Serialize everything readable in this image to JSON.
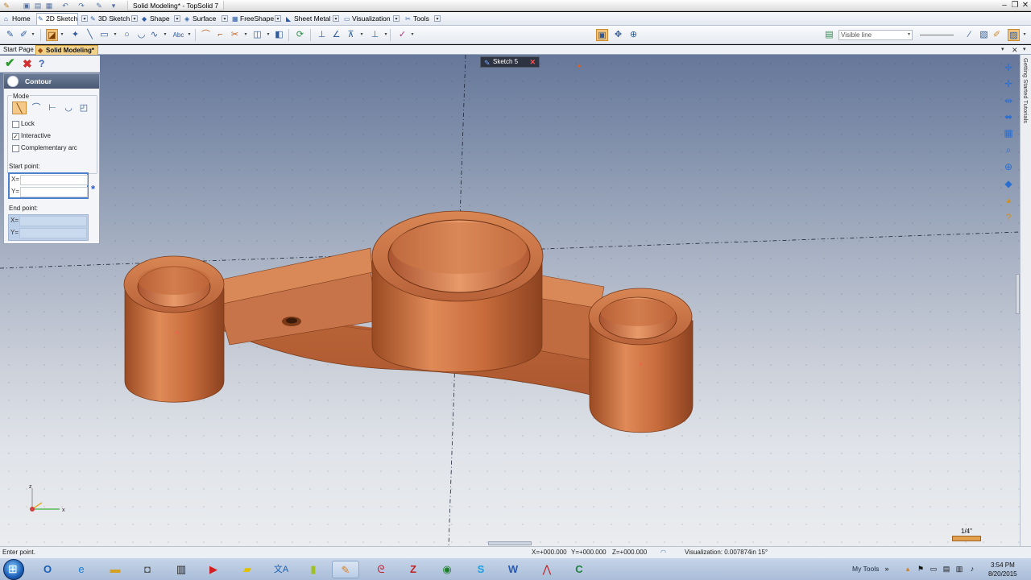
{
  "window": {
    "title": "Solid Modeling* - TopSolid 7",
    "minimize": "–",
    "restore": "❐",
    "close": "✕"
  },
  "menu": [
    {
      "label": "Home",
      "icon": "home-icon"
    },
    {
      "label": "2D Sketch",
      "icon": "pencil-icon"
    },
    {
      "label": "3D Sketch",
      "icon": "pencil-3d-icon"
    },
    {
      "label": "Shape",
      "icon": "shape-icon"
    },
    {
      "label": "Surface",
      "icon": "surface-icon"
    },
    {
      "label": "FreeShape",
      "icon": "freeshape-icon"
    },
    {
      "label": "Sheet Metal",
      "icon": "sheet-metal-icon"
    },
    {
      "label": "Visualization",
      "icon": "visualization-icon"
    },
    {
      "label": "Tools",
      "icon": "tools-icon"
    }
  ],
  "toolbar": {
    "layer_value": "Visible line"
  },
  "doc_tabs": {
    "start": "Start Page",
    "active": "Solid Modeling*"
  },
  "sketch_tab": {
    "label": "Sketch 5"
  },
  "contour": {
    "title": "Contour",
    "mode_label": "Mode",
    "lock_label": "Lock",
    "lock_checked": false,
    "interactive_label": "Interactive",
    "interactive_checked": true,
    "complementary_label": "Complementary arc",
    "complementary_checked": false,
    "start_point_label": "Start point:",
    "end_point_label": "End point:",
    "x_label": "X=",
    "y_label": "Y=",
    "start_x": "",
    "start_y": "",
    "end_x": "",
    "end_y": "",
    "pick_marker": "*"
  },
  "side_panel": {
    "label": "Getting Started Tutorials"
  },
  "scale": {
    "label": "1/4\""
  },
  "triad": {
    "x": "x",
    "z": "z"
  },
  "status": {
    "prompt": "Enter point.",
    "x": "X=+000.000",
    "y": "Y=+000.000",
    "z": "Z=+000.000",
    "visualization": "Visualization: 0.007874in 15°"
  },
  "taskbar": {
    "my_tools": "My Tools",
    "time": "3:54 PM",
    "date": "8/20/2015"
  },
  "colors": {
    "part_copper": "#c0683a",
    "active_tab": "#f2d28a",
    "panel_header": "#4a5873"
  }
}
